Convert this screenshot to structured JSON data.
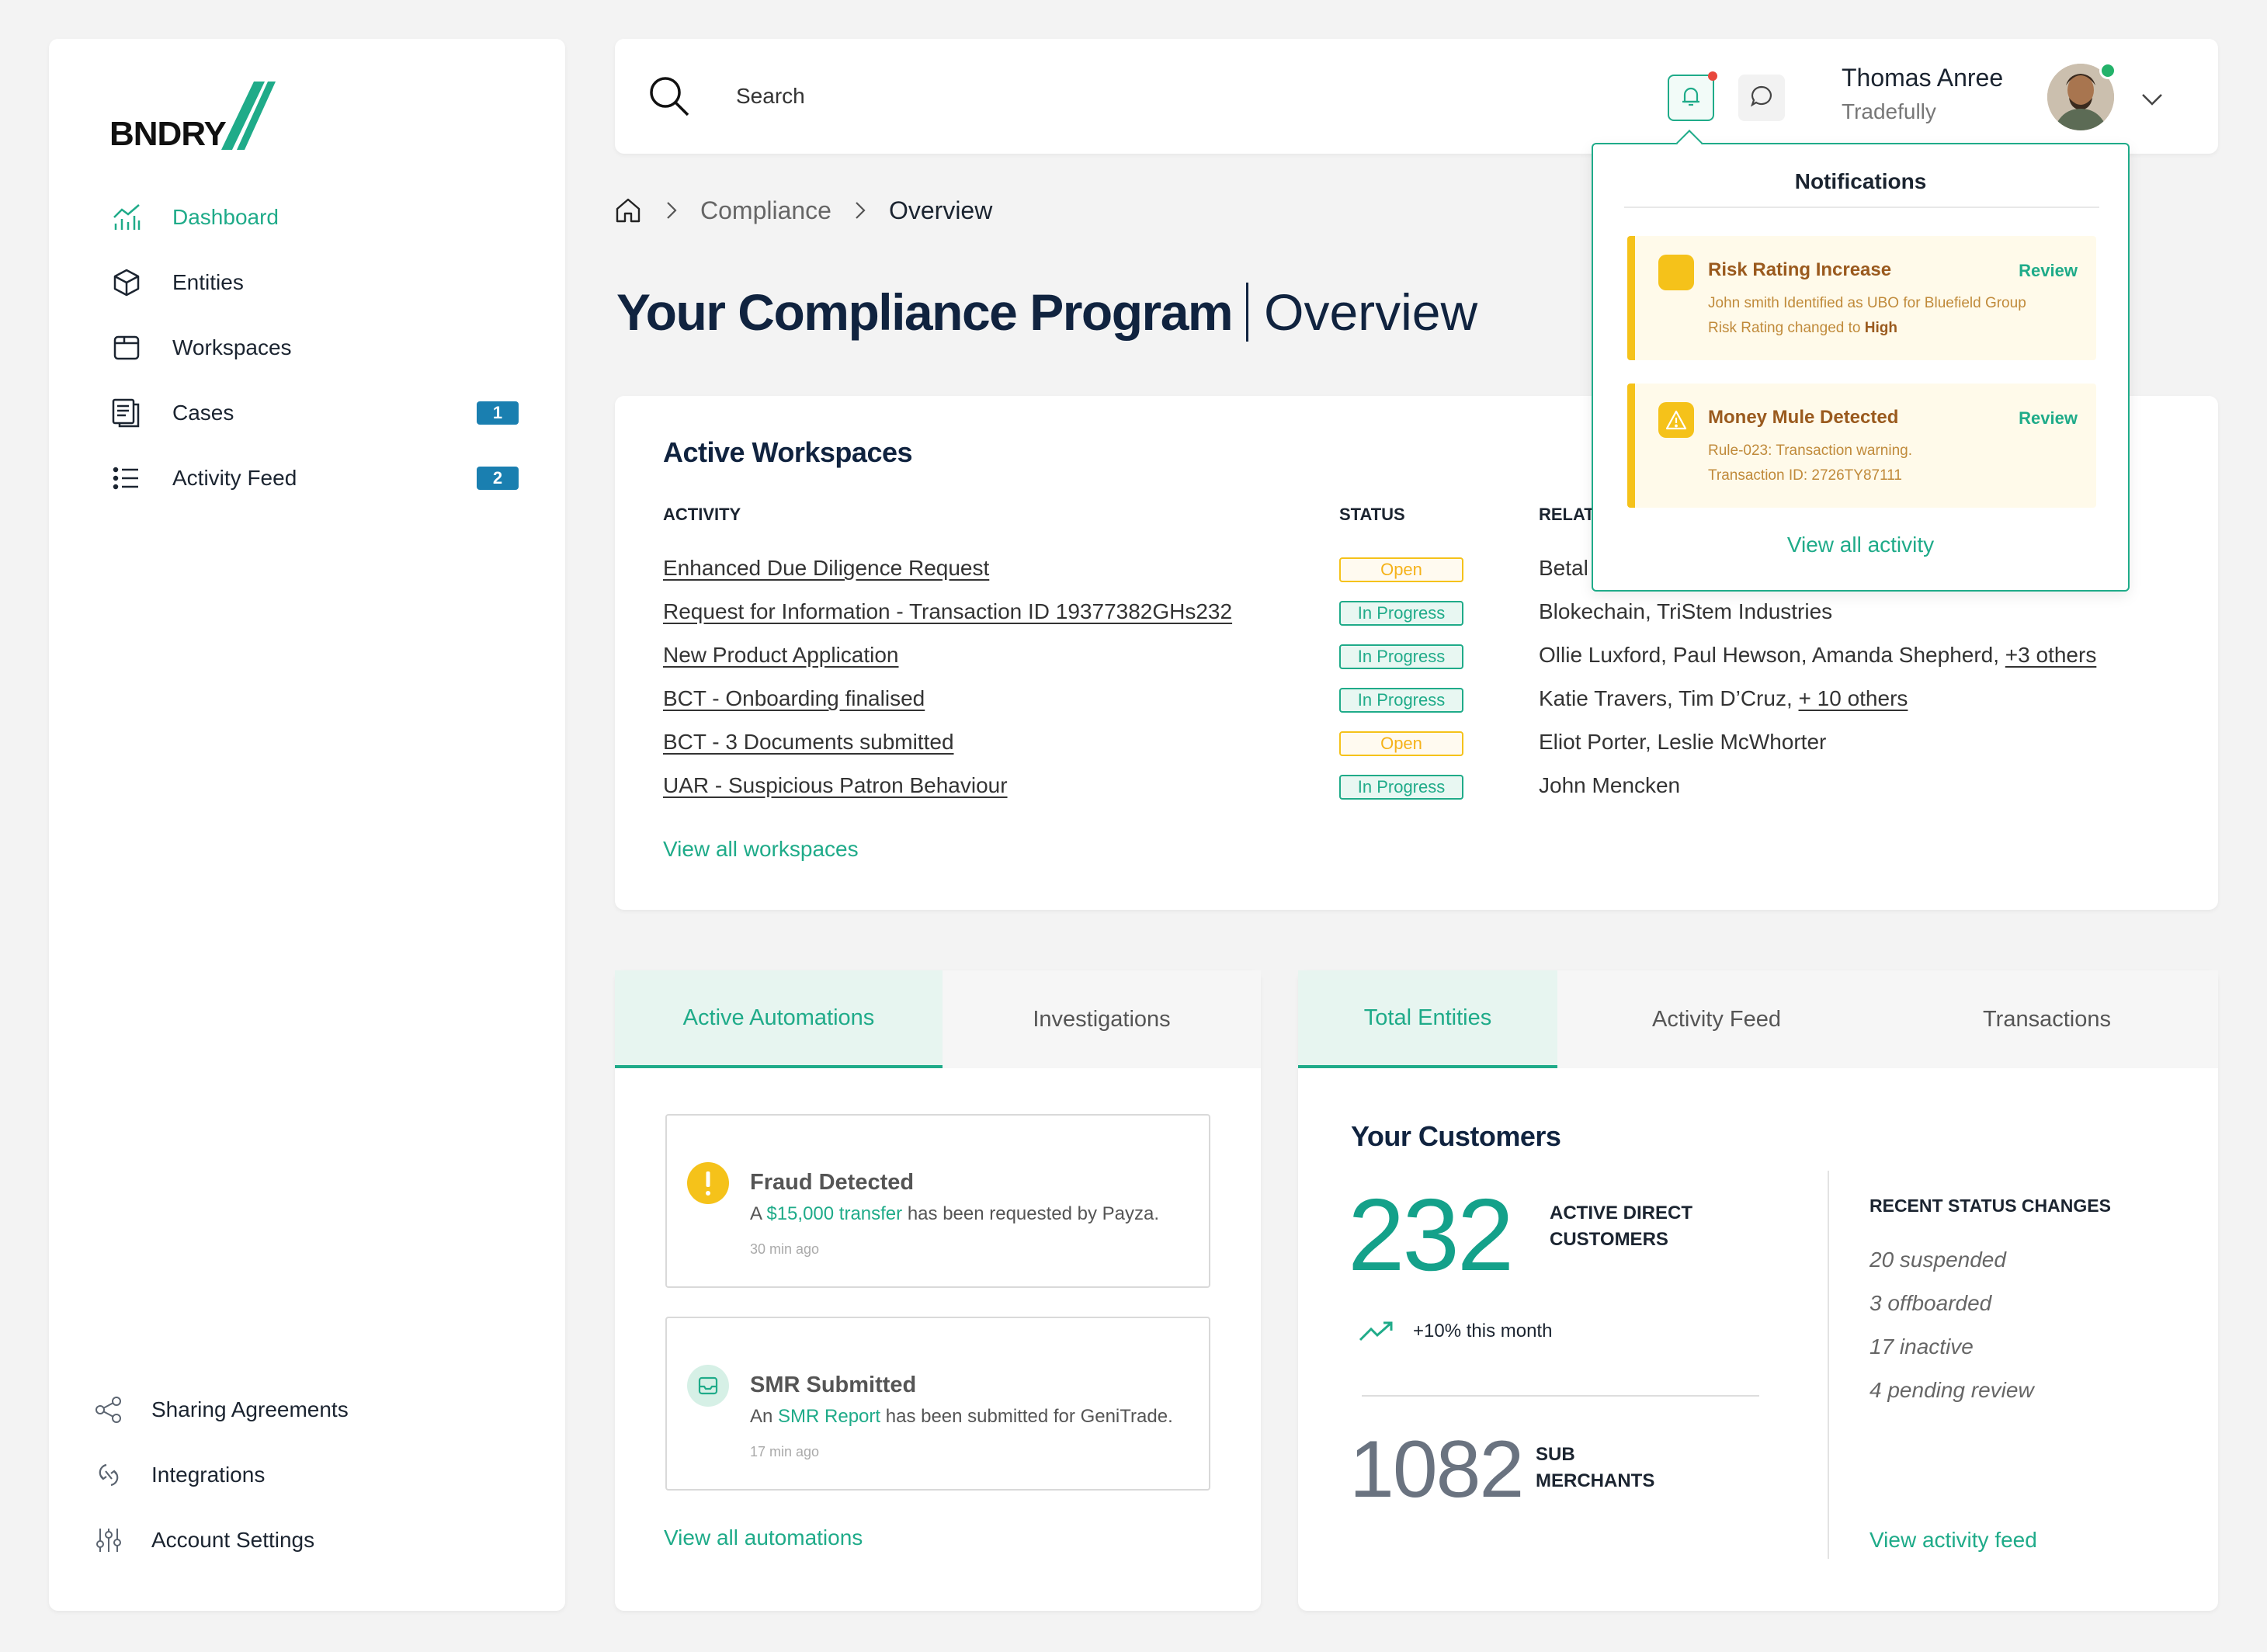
{
  "brand": {
    "logo_text": "BNDRY"
  },
  "sidebar": {
    "items": [
      {
        "label": "Dashboard"
      },
      {
        "label": "Entities"
      },
      {
        "label": "Workspaces"
      },
      {
        "label": "Cases",
        "badge": "1"
      },
      {
        "label": "Activity Feed",
        "badge": "2"
      }
    ],
    "bottom_items": [
      {
        "label": "Sharing Agreements"
      },
      {
        "label": "Integrations"
      },
      {
        "label": "Account Settings"
      }
    ]
  },
  "header": {
    "search_placeholder": "Search",
    "user": {
      "name": "Thomas Anree",
      "company": "Tradefully"
    }
  },
  "breadcrumb": {
    "section": "Compliance",
    "current": "Overview"
  },
  "page": {
    "title": "Your Compliance Program",
    "subtitle": "Overview"
  },
  "workspaces": {
    "title": "Active Workspaces",
    "columns": {
      "activity": "ACTIVITY",
      "status": "STATUS",
      "related": "RELAT"
    },
    "rows": [
      {
        "activity": "Enhanced Due Diligence Request",
        "status": "Open",
        "related": "Betal",
        "more": ""
      },
      {
        "activity": "Request for Information - Transaction ID 19377382GHs232",
        "status": "In Progress",
        "related": "Blokechain, TriStem Industries",
        "more": ""
      },
      {
        "activity": "New Product Application",
        "status": "In Progress",
        "related": "Ollie Luxford, Paul Hewson, Amanda Shepherd, ",
        "more": "+3 others"
      },
      {
        "activity": "BCT - Onboarding finalised",
        "status": "In Progress",
        "related": "Katie Travers, Tim D’Cruz, ",
        "more": "+ 10 others"
      },
      {
        "activity": "BCT - 3 Documents submitted",
        "status": "Open",
        "related": "Eliot Porter, Leslie McWhorter",
        "more": ""
      },
      {
        "activity": "UAR - Suspicious Patron Behaviour",
        "status": "In Progress",
        "related": "John Mencken",
        "more": ""
      }
    ],
    "view_all": "View all workspaces"
  },
  "automations": {
    "tabs": [
      "Active Automations",
      "Investigations"
    ],
    "items": [
      {
        "title": "Fraud Detected",
        "pre": "A ",
        "link": "$15,000 transfer",
        "post": " has been requested by Payza.",
        "time": "30 min ago"
      },
      {
        "title": "SMR Submitted",
        "pre": "An ",
        "link": "SMR Report",
        "post": " has been submitted for GeniTrade.",
        "time": "17 min ago"
      }
    ],
    "view_all": "View all automations"
  },
  "entities": {
    "tabs": [
      "Total Entities",
      "Activity Feed",
      "Transactions"
    ],
    "title": "Your Customers",
    "active_count": "232",
    "active_label_1": "ACTIVE DIRECT",
    "active_label_2": "CUSTOMERS",
    "trend": "+10% this month",
    "sub_count": "1082",
    "sub_label_1": "SUB",
    "sub_label_2": "MERCHANTS",
    "recent_title": "RECENT STATUS CHANGES",
    "recent": [
      "20 suspended",
      "3 offboarded",
      "17 inactive",
      "4 pending review"
    ],
    "view_feed": "View activity feed"
  },
  "notifications": {
    "title": "Notifications",
    "items": [
      {
        "title": "Risk Rating Increase",
        "action": "Review",
        "line1": "John smith Identified as UBO for Bluefield Group",
        "line2_pre": "Risk Rating changed to ",
        "line2_bold": "High"
      },
      {
        "title": "Money Mule Detected",
        "action": "Review",
        "line1": "Rule-023: Transaction warning.",
        "line2_pre": "Transaction ID: 2726TY87111",
        "line2_bold": ""
      }
    ],
    "view_all": "View all activity"
  },
  "colors": {
    "accent": "#1fab89",
    "navy": "#10233f",
    "badge": "#1a7fb0",
    "warning": "#f5c21a"
  }
}
